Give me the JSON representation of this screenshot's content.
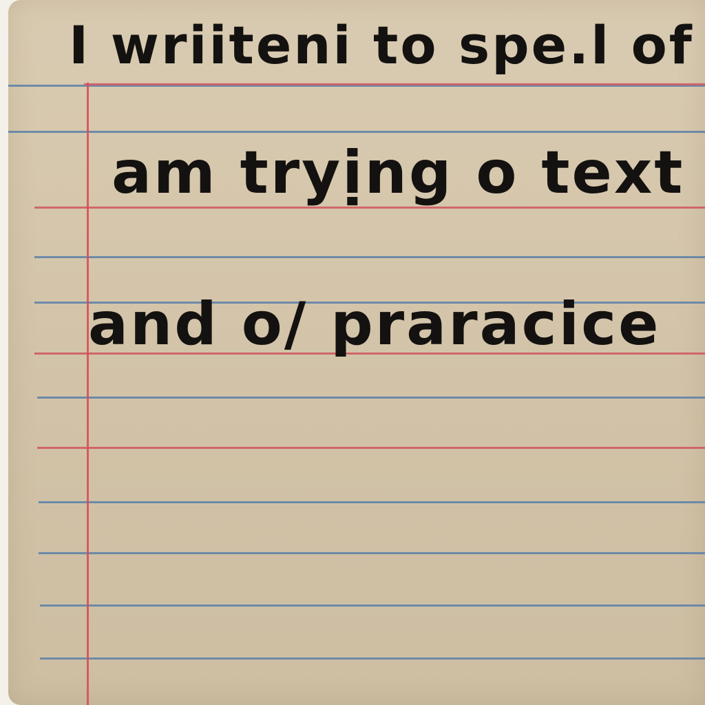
{
  "note": {
    "lines": [
      "I wriiteni to spe.l of",
      "am tryịng o text",
      "and o/ praracice"
    ]
  },
  "colors": {
    "paper": "#d6c8ad",
    "blue_rule": "#5b7fa8",
    "red_rule": "#d0555f",
    "ink": "#141210"
  }
}
